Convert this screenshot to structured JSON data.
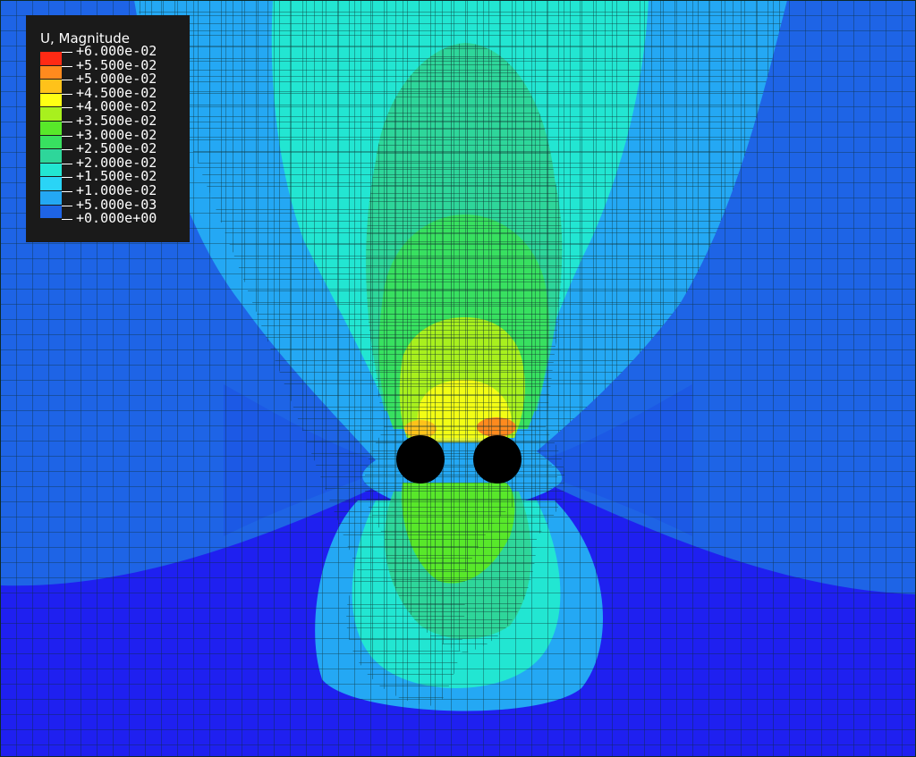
{
  "legend": {
    "title": "U, Magnitude",
    "labels": [
      "+6.000e-02",
      "+5.500e-02",
      "+5.000e-02",
      "+4.500e-02",
      "+4.000e-02",
      "+3.500e-02",
      "+3.000e-02",
      "+2.500e-02",
      "+2.000e-02",
      "+1.500e-02",
      "+1.000e-02",
      "+5.000e-03",
      "+0.000e+00"
    ],
    "colors": [
      "#ff2a14",
      "#ff8a1e",
      "#ffc21a",
      "#ffff14",
      "#a8f01e",
      "#58e82a",
      "#38e060",
      "#2ed69a",
      "#22e6d2",
      "#2ad4f6",
      "#24a8f4",
      "#1e64e6",
      "#1f20f0"
    ]
  },
  "plot": {
    "background_color": "#1e64e6",
    "mesh_line_color": "#0d2a2a",
    "hole_color": "#000000"
  }
}
